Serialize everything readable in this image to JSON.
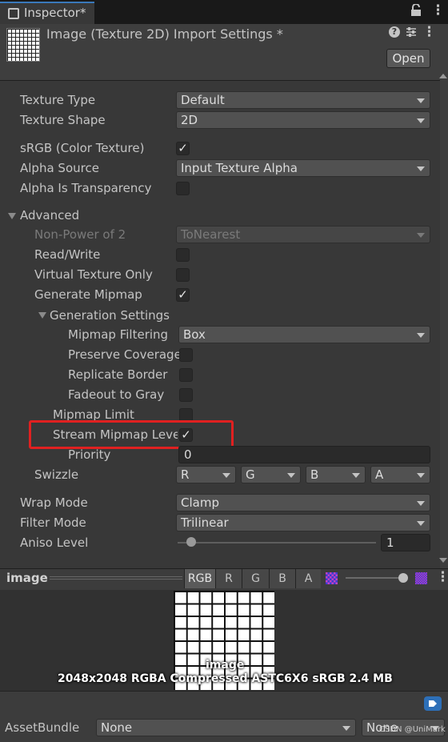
{
  "tab": {
    "title": "Inspector*"
  },
  "header": {
    "title": "Image (Texture 2D) Import Settings *",
    "open_label": "Open"
  },
  "rows": {
    "texture_type": {
      "label": "Texture Type",
      "value": "Default"
    },
    "texture_shape": {
      "label": "Texture Shape",
      "value": "2D"
    },
    "srgb": {
      "label": "sRGB (Color Texture)",
      "checked": "✓"
    },
    "alpha_source": {
      "label": "Alpha Source",
      "value": "Input Texture Alpha"
    },
    "alpha_is_transparency": {
      "label": "Alpha Is Transparency"
    },
    "advanced": {
      "label": "Advanced"
    },
    "non_power_of_2": {
      "label": "Non-Power of 2",
      "value": "ToNearest"
    },
    "read_write": {
      "label": "Read/Write"
    },
    "virtual_texture_only": {
      "label": "Virtual Texture Only"
    },
    "generate_mipmap": {
      "label": "Generate Mipmap",
      "checked": "✓"
    },
    "generation_settings": {
      "label": "Generation Settings"
    },
    "mipmap_filtering": {
      "label": "Mipmap Filtering",
      "value": "Box"
    },
    "preserve_coverage": {
      "label": "Preserve Coverage"
    },
    "replicate_border": {
      "label": "Replicate Border"
    },
    "fadeout_to_gray": {
      "label": "Fadeout to Gray"
    },
    "mipmap_limit": {
      "label": "Mipmap Limit"
    },
    "stream_mipmap_levels": {
      "label": "Stream Mipmap Levels",
      "checked": "✓"
    },
    "priority": {
      "label": "Priority",
      "value": "0"
    },
    "swizzle": {
      "label": "Swizzle",
      "r": "R",
      "g": "G",
      "b": "B",
      "a": "A"
    },
    "wrap_mode": {
      "label": "Wrap Mode",
      "value": "Clamp"
    },
    "filter_mode": {
      "label": "Filter Mode",
      "value": "Trilinear"
    },
    "aniso_level": {
      "label": "Aniso Level",
      "value": "1",
      "level": 0.07
    }
  },
  "preview": {
    "name": "image",
    "channels": [
      "RGB",
      "R",
      "G",
      "B",
      "A"
    ],
    "image_label": "image",
    "info": "2048x2048  RGBA Compressed ASTC6X6 sRGB  2.4 MB"
  },
  "assetbundle": {
    "label": "AssetBundle",
    "name_value": "None",
    "variant_value": "None"
  },
  "watermark": "CSDN @UniMark"
}
